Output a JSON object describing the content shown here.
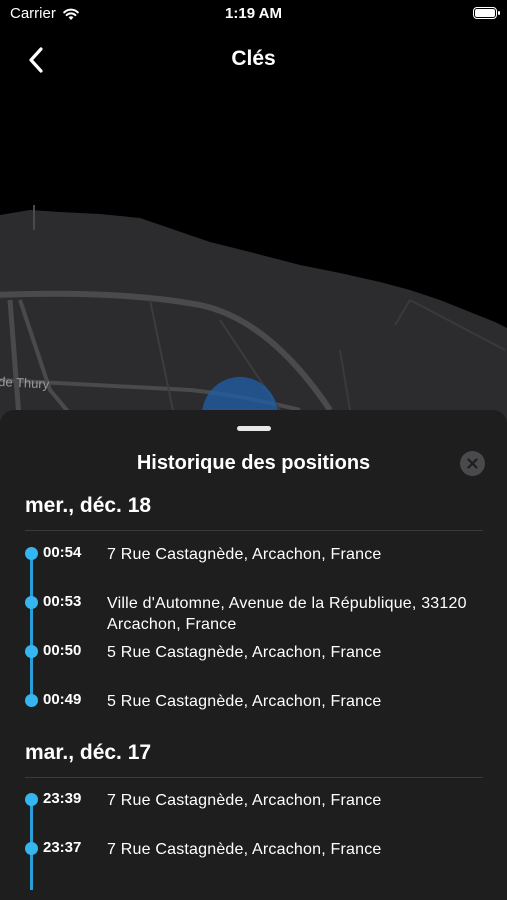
{
  "status_bar": {
    "carrier": "Carrier",
    "time": "1:19 AM"
  },
  "nav": {
    "title": "Clés"
  },
  "map": {
    "street_label": "de Thury"
  },
  "sheet": {
    "title": "Historique des positions",
    "days": [
      {
        "date": "mer., déc. 18",
        "entries": [
          {
            "time": "00:54",
            "address": "7 Rue Castagnède, Arcachon, France"
          },
          {
            "time": "00:53",
            "address": "Ville d'Automne, Avenue de la République, 33120 Arcachon, France"
          },
          {
            "time": "00:50",
            "address": "5 Rue Castagnède, Arcachon, France"
          },
          {
            "time": "00:49",
            "address": "5 Rue Castagnède, Arcachon, France"
          }
        ]
      },
      {
        "date": "mar., déc. 17",
        "entries": [
          {
            "time": "23:39",
            "address": "7 Rue Castagnède, Arcachon, France"
          },
          {
            "time": "23:37",
            "address": "7 Rue Castagnède, Arcachon, France"
          }
        ]
      }
    ]
  },
  "colors": {
    "accent": "#35b6f0",
    "sheet_bg": "#1e1e1f",
    "map_land": "#2c2c2e"
  },
  "icons": {
    "back": "chevron-left-icon",
    "close": "close-icon",
    "wifi": "wifi-icon",
    "battery": "battery-icon"
  }
}
